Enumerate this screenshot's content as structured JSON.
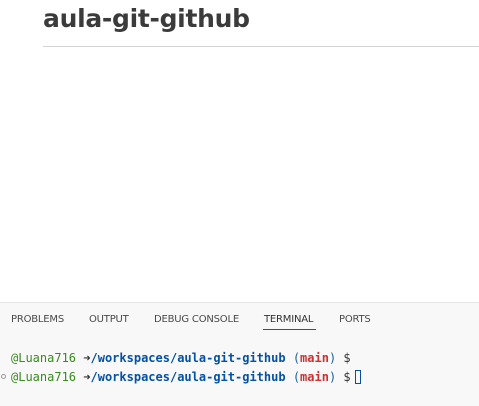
{
  "preview": {
    "title": "aula-git-github"
  },
  "panel": {
    "tabs": [
      {
        "label": "PROBLEMS"
      },
      {
        "label": "OUTPUT"
      },
      {
        "label": "DEBUG CONSOLE"
      },
      {
        "label": "TERMINAL",
        "active": true
      },
      {
        "label": "PORTS"
      }
    ]
  },
  "terminal": {
    "lines": [
      {
        "user": "@Luana716",
        "arrow": "➜",
        "path": "/workspaces/aula-git-github",
        "paren_open": "(",
        "branch": "main",
        "paren_close": ")",
        "prompt": "$"
      },
      {
        "user": "@Luana716",
        "arrow": "➜",
        "path": "/workspaces/aula-git-github",
        "paren_open": "(",
        "branch": "main",
        "paren_close": ")",
        "prompt": "$"
      }
    ]
  },
  "colors": {
    "accent": "#005fb8",
    "user": "#3a8a1e",
    "path": "#0451a5",
    "branch": "#cd3131"
  }
}
